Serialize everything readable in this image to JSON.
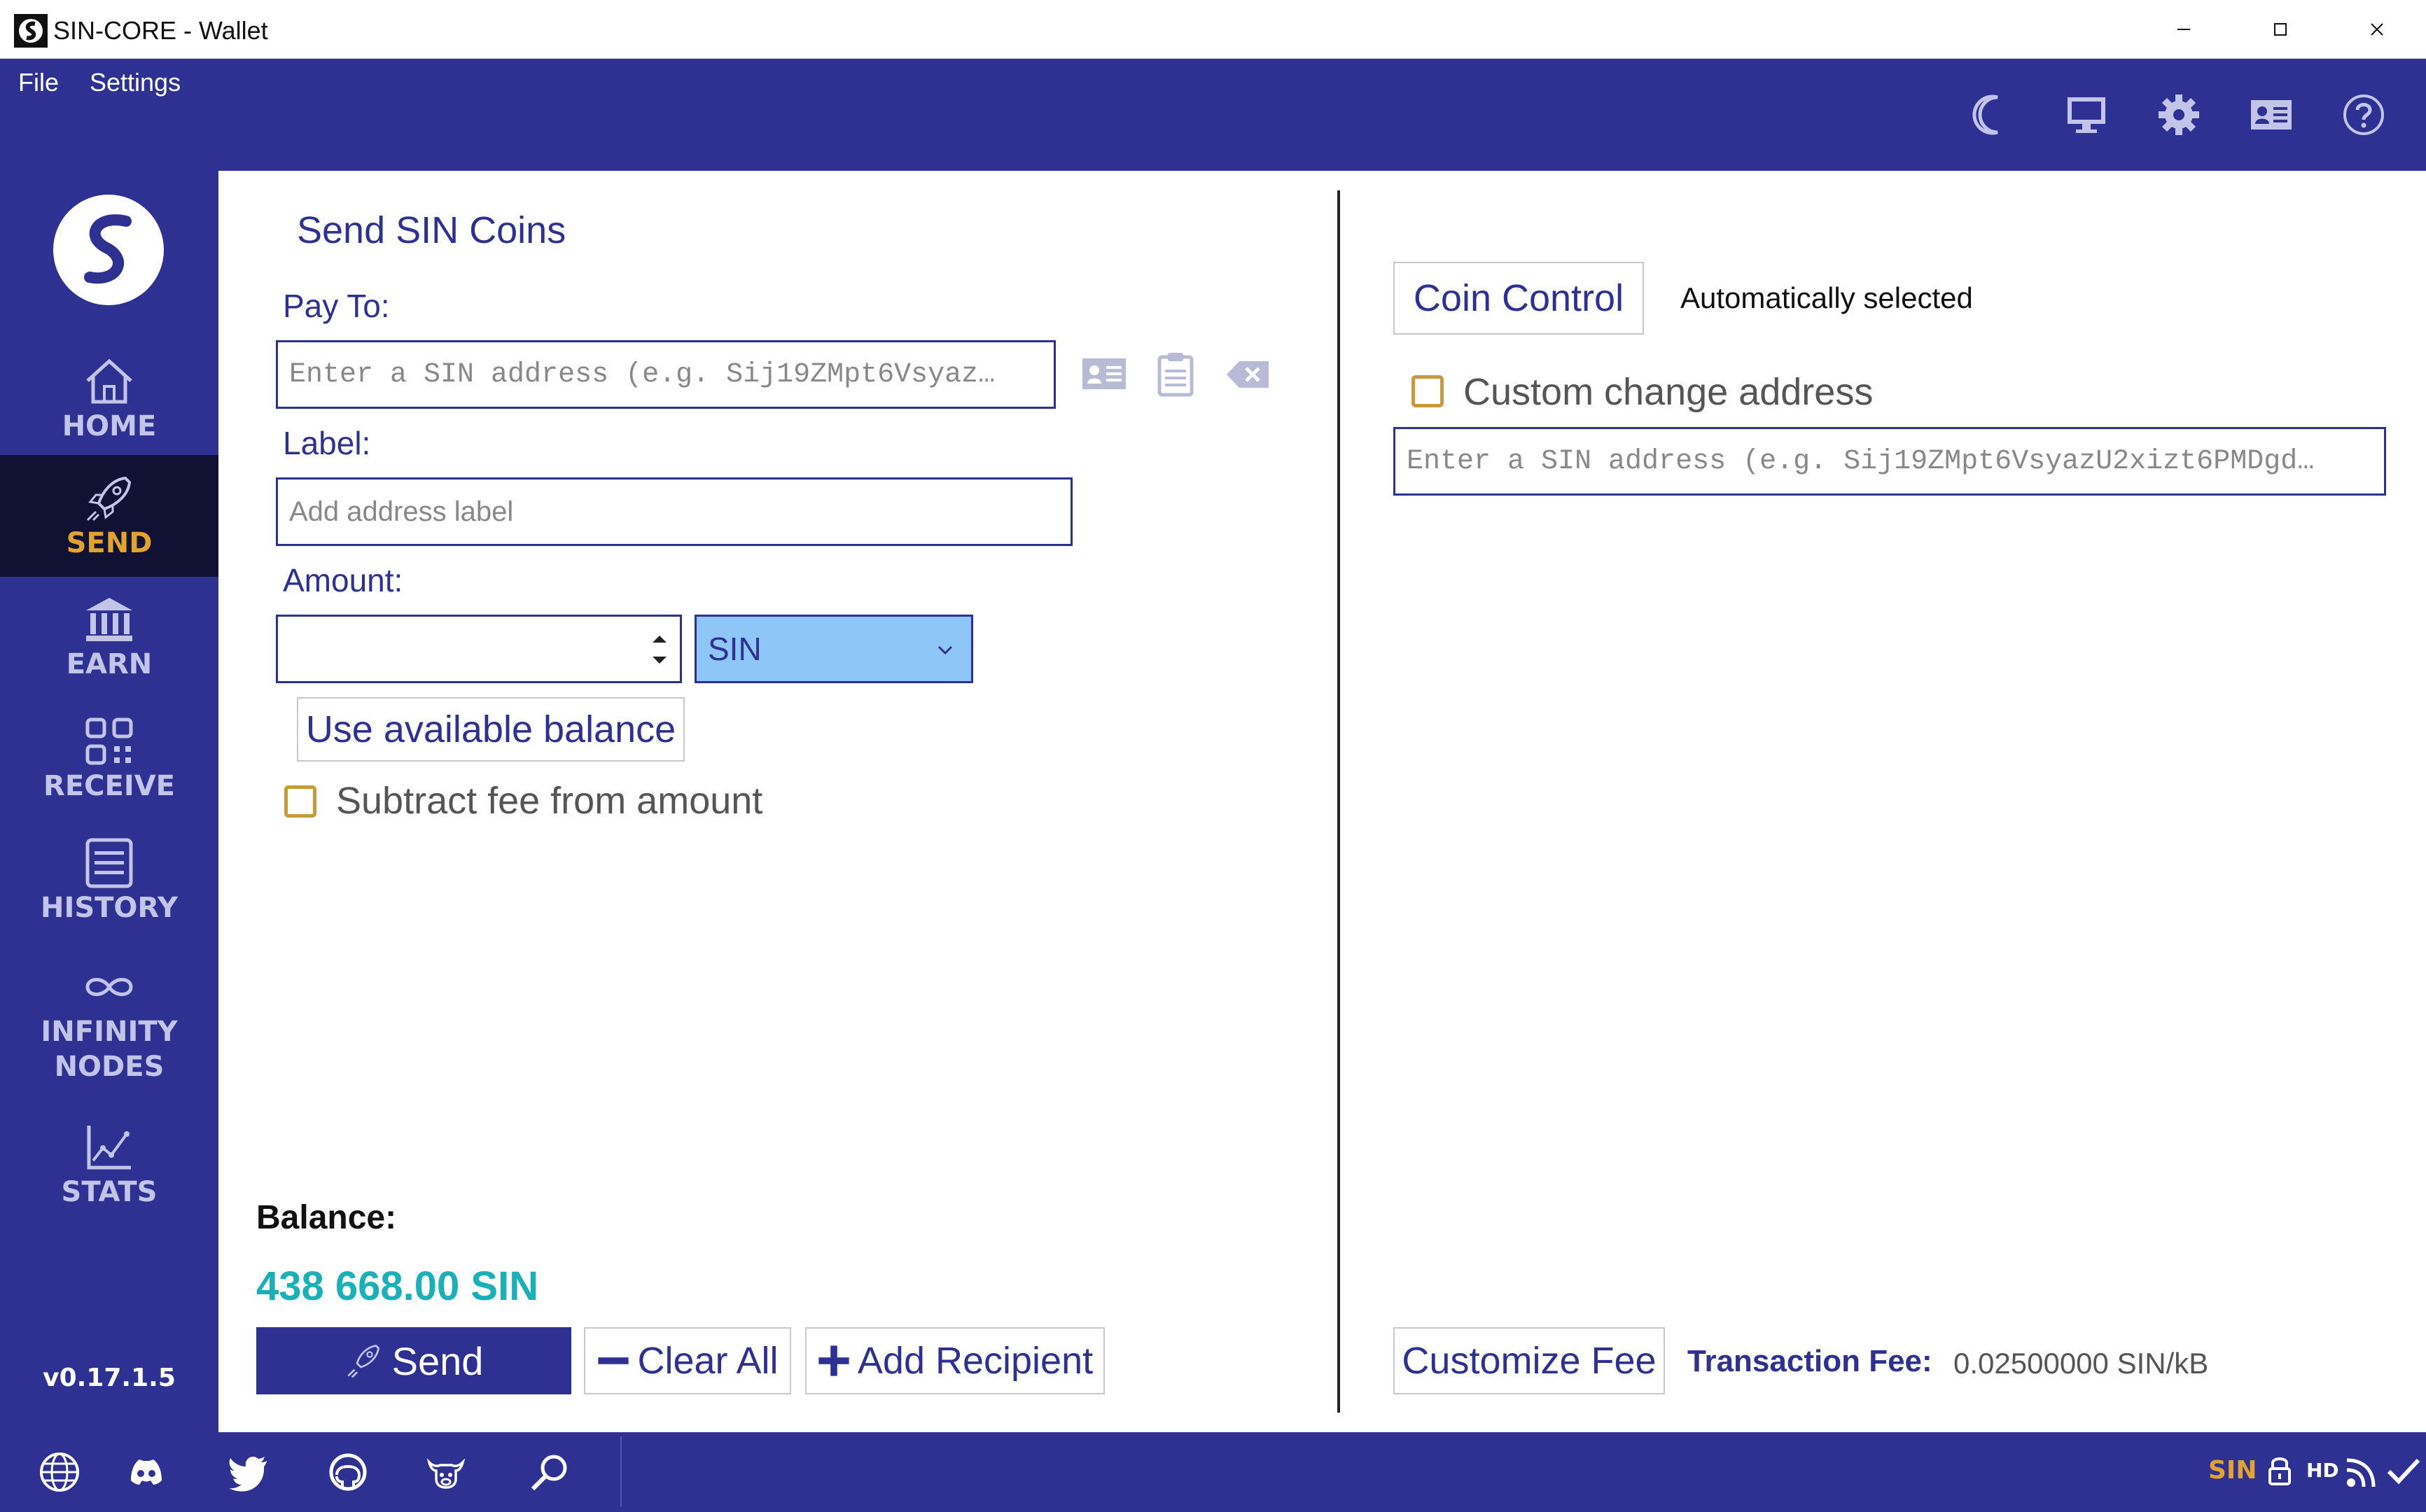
{
  "window": {
    "title": "SIN-CORE - Wallet"
  },
  "menu": [
    "File",
    "Settings"
  ],
  "header_icons": [
    "moon-icon",
    "monitor-icon",
    "gear-icon",
    "contact-card-icon",
    "help-icon"
  ],
  "sidebar": {
    "items": [
      {
        "label": "HOME",
        "icon": "home-icon",
        "active": false
      },
      {
        "label": "SEND",
        "icon": "rocket-icon",
        "active": true
      },
      {
        "label": "EARN",
        "icon": "bank-icon",
        "active": false
      },
      {
        "label": "RECEIVE",
        "icon": "qr-code-icon",
        "active": false
      },
      {
        "label": "HISTORY",
        "icon": "history-icon",
        "active": false
      },
      {
        "label": "INFINITY NODES",
        "icon": "infinity-icon",
        "active": false
      },
      {
        "label": "STATS",
        "icon": "stats-icon",
        "active": false
      }
    ],
    "version": "v0.17.1.5"
  },
  "send": {
    "title": "Send SIN Coins",
    "pay_to": {
      "label": "Pay To:",
      "placeholder": "Enter a SIN address (e.g. Sij19ZMpt6Vsyaz…"
    },
    "label_field": {
      "label": "Label:",
      "placeholder": "Add address label"
    },
    "amount": {
      "label": "Amount:",
      "value": "",
      "unit": "SIN"
    },
    "use_balance_label": "Use available balance",
    "subtract_fee_label": "Subtract fee from amount",
    "balance_label": "Balance:",
    "balance_value": "438 668.00 SIN",
    "send_label": "Send",
    "clear_all_label": "Clear All",
    "add_recipient_label": "Add Recipient"
  },
  "coin_control": {
    "button_label": "Coin Control",
    "status": "Automatically selected",
    "custom_change_label": "Custom change address",
    "change_placeholder": "Enter a SIN address (e.g. Sij19ZMpt6VsyazU2xizt6PMDgd…"
  },
  "fee": {
    "button_label": "Customize Fee",
    "label": "Transaction Fee:",
    "value": "0.02500000 SIN/kB"
  },
  "footer": {
    "icons": [
      "globe-icon",
      "discord-icon",
      "twitter-icon",
      "github-icon",
      "bull-icon",
      "search-icon"
    ],
    "status": {
      "unit": "SIN",
      "hd": "HD"
    }
  },
  "colors": {
    "brand": "#2e3192",
    "accent_gold": "#e0a42e",
    "balance": "#1ab0b8",
    "unit_select": "#8ec6f7"
  }
}
